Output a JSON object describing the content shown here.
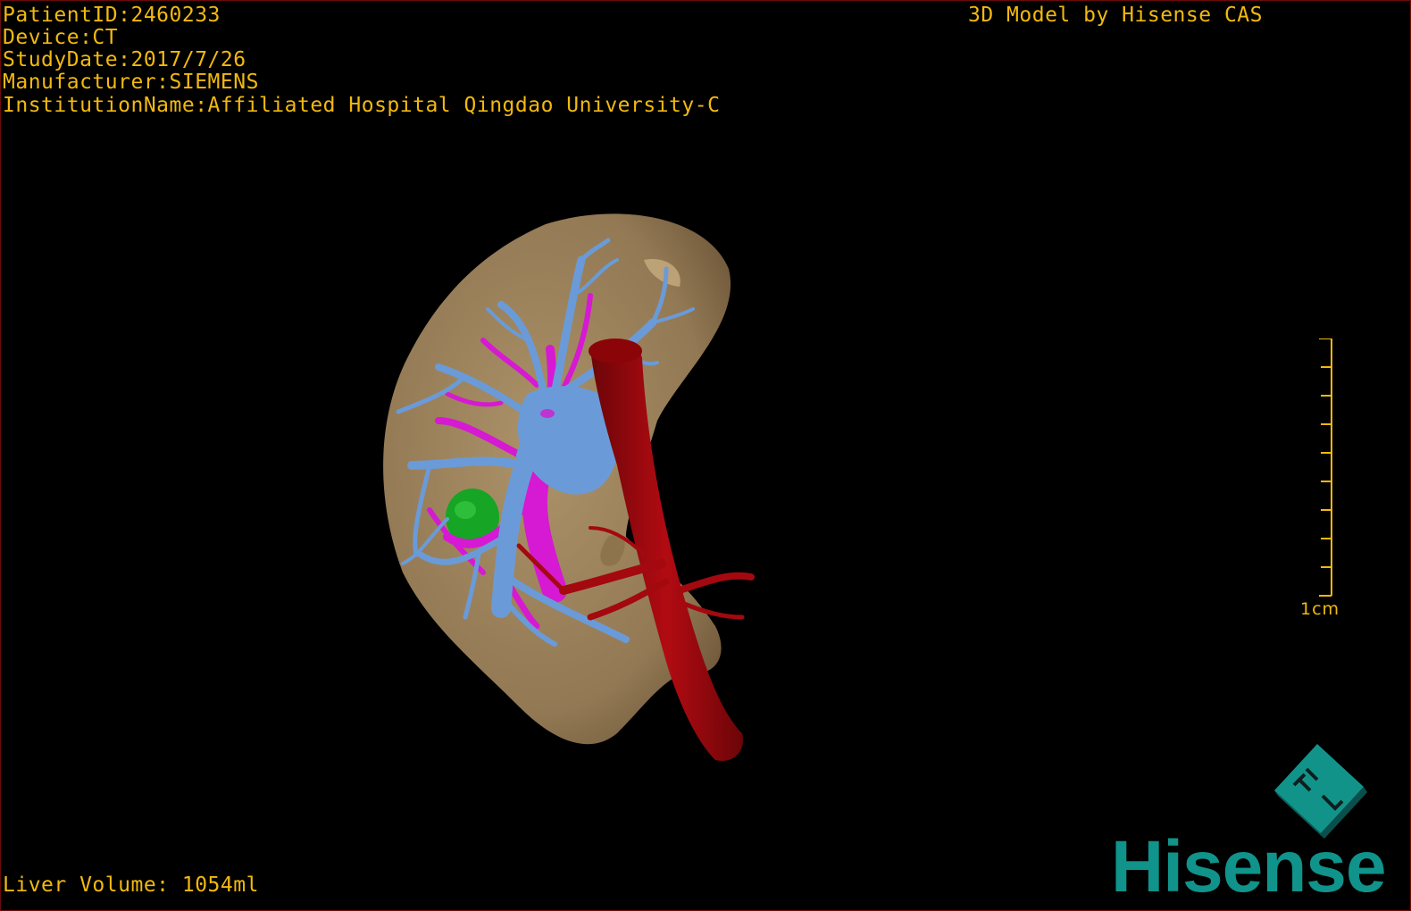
{
  "overlay": {
    "patient_id": "PatientID:2460233",
    "device": "Device:CT",
    "study_date": "StudyDate:2017/7/26",
    "manufacturer": "Manufacturer:SIEMENS",
    "institution": "InstitutionName:Affiliated Hospital Qingdao University-C",
    "title": "3D Model by Hisense CAS",
    "liver_volume": "Liver Volume: 1054ml"
  },
  "scale": {
    "label": "1cm"
  },
  "brand": {
    "name": "Hisense"
  },
  "colors": {
    "overlay_text": "#f2b90f",
    "liver": "#a58b62",
    "portal_vein": "#6a9bd8",
    "hepatic_artery": "#d619d2",
    "vena_cava": "#a3090f",
    "lesion": "#16a524",
    "brand": "#10938a"
  }
}
